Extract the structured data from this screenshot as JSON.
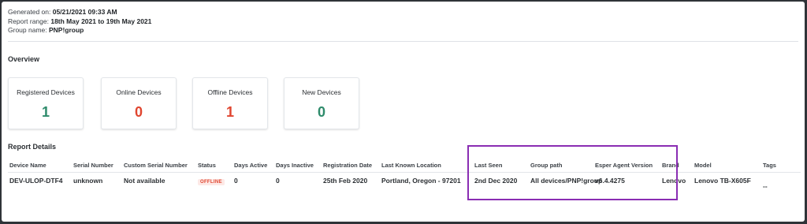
{
  "meta": {
    "generated_label": "Generated on: ",
    "generated_value": "05/21/2021 09:33 AM",
    "range_label": "Report range: ",
    "range_value": "18th May 2021 to 19th May 2021",
    "group_label": "Group name: ",
    "group_value": "PNP!group"
  },
  "overview": {
    "title": "Overview",
    "cards": [
      {
        "label": "Registered Devices",
        "value": "1"
      },
      {
        "label": "Online Devices",
        "value": "0"
      },
      {
        "label": "Offline Devices",
        "value": "1"
      },
      {
        "label": "New Devices",
        "value": "0"
      }
    ]
  },
  "report": {
    "title": "Report Details",
    "columns": [
      "Device Name",
      "Serial Number",
      "Custom Serial Number",
      "Status",
      "Days Active",
      "Days Inactive",
      "Registration Date",
      "Last Known Location",
      "Last Seen",
      "Group path",
      "Esper Agent Version",
      "Brand",
      "Model",
      "Tags"
    ],
    "row": {
      "device_name": "DEV-ULOP-DTF4",
      "serial_number": "unknown",
      "custom_serial": "Not available",
      "status": "OFFLINE",
      "days_active": "0",
      "days_inactive": "0",
      "registration_date": "25th Feb 2020",
      "location": "Portland, Oregon - 97201",
      "last_seen": "2nd Dec 2020",
      "group_path": "All devices/PNP!group",
      "agent_version": "v6.4.4275",
      "brand": "Lenovo",
      "model": "Lenovo TB-X605F",
      "tags": "--"
    }
  },
  "colors": {
    "highlight": "#8a2db3",
    "positive": "#2e8b6b",
    "negative": "#e0452f",
    "link": "#2f6fd1"
  }
}
